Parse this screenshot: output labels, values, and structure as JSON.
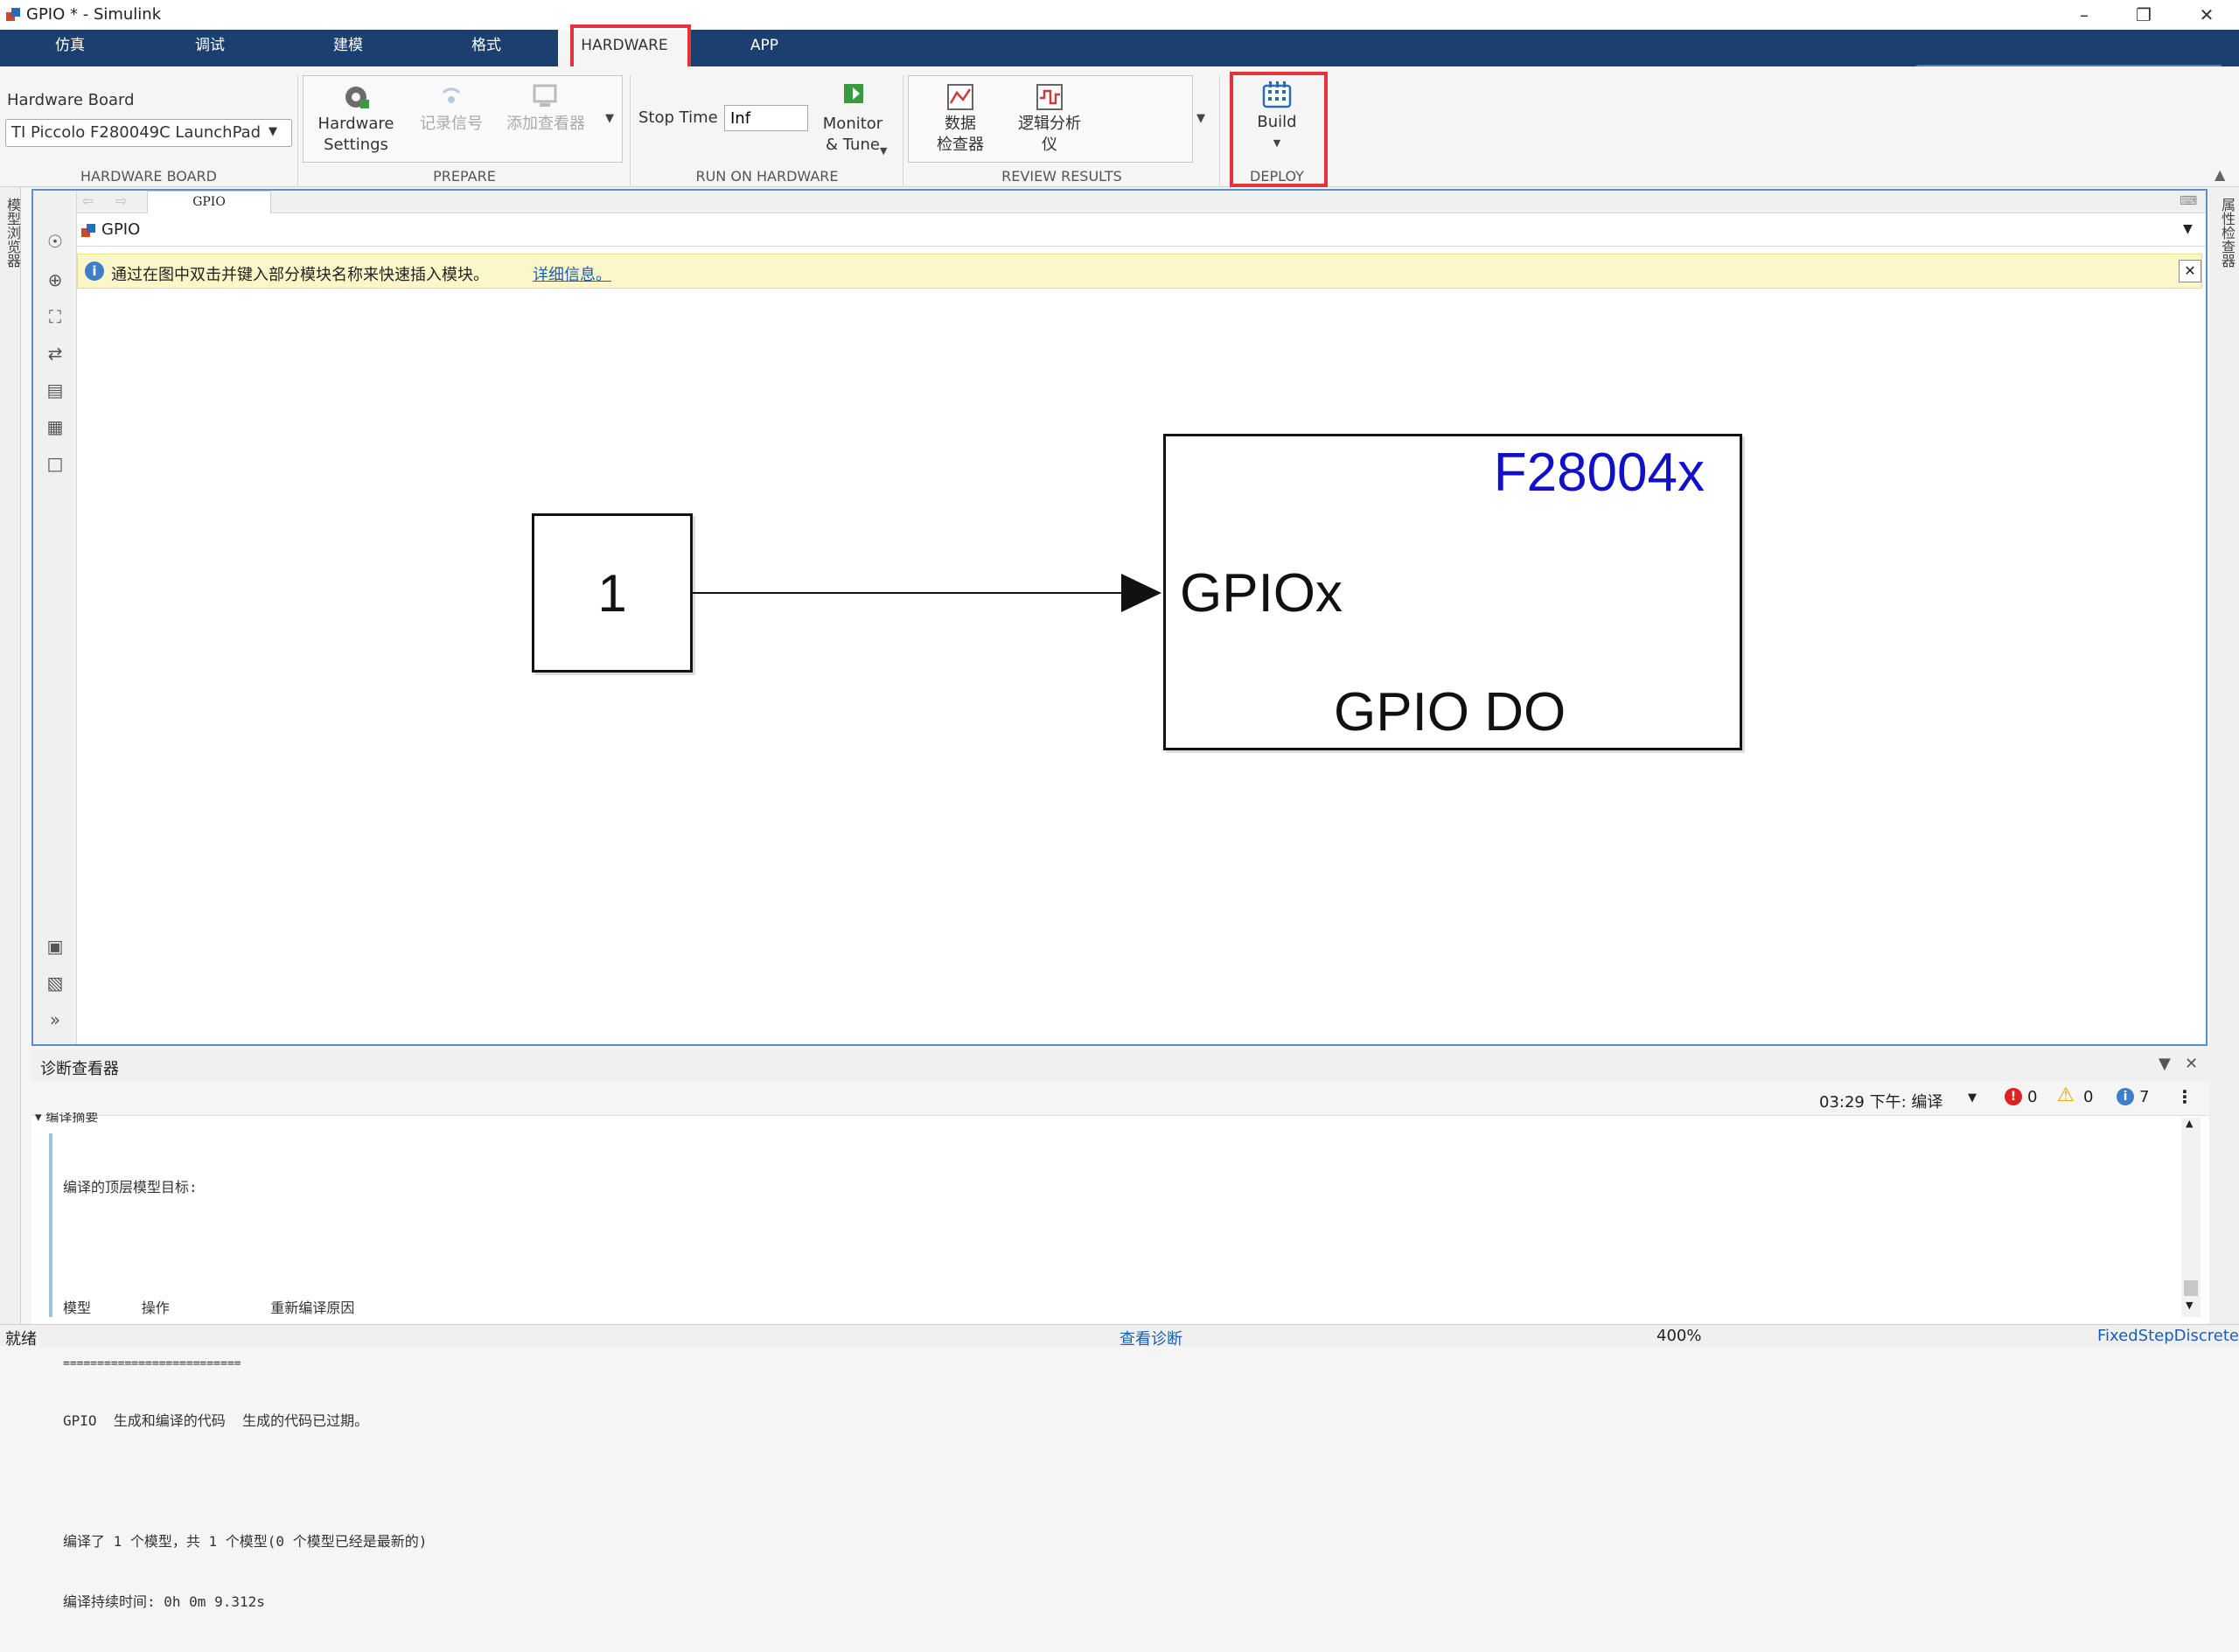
{
  "window": {
    "title": "GPIO * - Simulink",
    "minimize_icon": "minimize-icon",
    "restore_icon": "restore-icon",
    "close_icon": "close-icon"
  },
  "tabs": [
    {
      "label": "仿真"
    },
    {
      "label": "调试"
    },
    {
      "label": "建模"
    },
    {
      "label": "格式"
    },
    {
      "label": "HARDWARE"
    },
    {
      "label": "APP"
    }
  ],
  "ribbon": {
    "hardware_board": {
      "heading": "Hardware Board",
      "selected": "TI Piccolo F280049C LaunchPad",
      "group_label": "HARDWARE BOARD"
    },
    "prepare": {
      "hardware_settings_line1": "Hardware",
      "hardware_settings_line2": "Settings",
      "log_signals": "记录信号",
      "add_viewer": "添加查看器",
      "group_label": "PREPARE"
    },
    "run": {
      "stop_time_label": "Stop Time",
      "stop_time_value": "Inf",
      "monitor_line1": "Monitor",
      "monitor_line2": "& Tune",
      "group_label": "RUN ON HARDWARE"
    },
    "review": {
      "data_inspector_line1": "数据",
      "data_inspector_line2": "检查器",
      "logic_analyzer_line1": "逻辑分析",
      "logic_analyzer_line2": "仪",
      "group_label": "REVIEW RESULTS"
    },
    "deploy": {
      "build_label": "Build",
      "group_label": "DEPLOY"
    }
  },
  "side_panels": {
    "left": "模型浏览器",
    "right": "属性检查器"
  },
  "editor": {
    "tab_label": "GPIO",
    "address": "GPIO",
    "info_message": "通过在图中双击并键入部分模块名称来快速插入模块。",
    "info_link": "详细信息。"
  },
  "diagram": {
    "constant_value": "1",
    "gpio_block": {
      "family": "F28004x",
      "port_label": "GPIOx",
      "name": "GPIO DO"
    }
  },
  "diagnostics": {
    "title": "诊断查看器",
    "timestamp_label": "03:29 下午: 编译",
    "errors": "0",
    "warnings": "0",
    "infos": "7",
    "section_title": "编译摘要",
    "lines": [
      "编译的顶层模型目标:",
      "",
      "模型      操作            重新编译原因",
      "==========================",
      "GPIO  生成和编译的代码  生成的代码已过期。",
      "",
      "编译了 1 个模型，共 1 个模型(0 个模型已经是最新的)",
      "编译持续时间: 0h 0m 9.312s"
    ]
  },
  "status": {
    "left": "就绪",
    "center": "查看诊断",
    "zoom": "400%",
    "solver": "FixedStepDiscrete"
  },
  "colors": {
    "tabbar": "#1b3f6f",
    "highlight": "#e2323a",
    "family_text": "#1010c8",
    "info_bg": "#fbf7c8",
    "link": "#1a5fb4"
  }
}
